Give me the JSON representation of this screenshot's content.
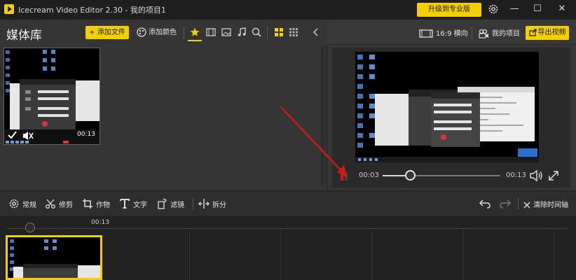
{
  "app": {
    "title": "Icecream Video Editor 2.30 - 我的项目1",
    "upgrade_label": "升级到专业版",
    "minimize": "—",
    "maximize": "☐",
    "close": "✕"
  },
  "library": {
    "title": "媒体库",
    "add_file_label": "+ 添加文件",
    "add_color_label": "添加颜色",
    "thumb_duration": "00:13"
  },
  "right_toolbar": {
    "aspect_label": "16:9 横向",
    "project_label": "我的项目",
    "export_label": "导出视频"
  },
  "player": {
    "current_time": "00:03",
    "total_time": "00:13",
    "progress": 0.23
  },
  "timeline_toolbar": {
    "general_label": "常规",
    "trim_label": "修剪",
    "crop_label": "作物",
    "text_label": "文字",
    "filter_label": "滤镜",
    "split_label": "拆分",
    "clear_label": "清除时间轴"
  },
  "timeline": {
    "ruler_label": "00:13"
  },
  "colors": {
    "accent": "#f5d000",
    "arrow": "#d01818"
  }
}
